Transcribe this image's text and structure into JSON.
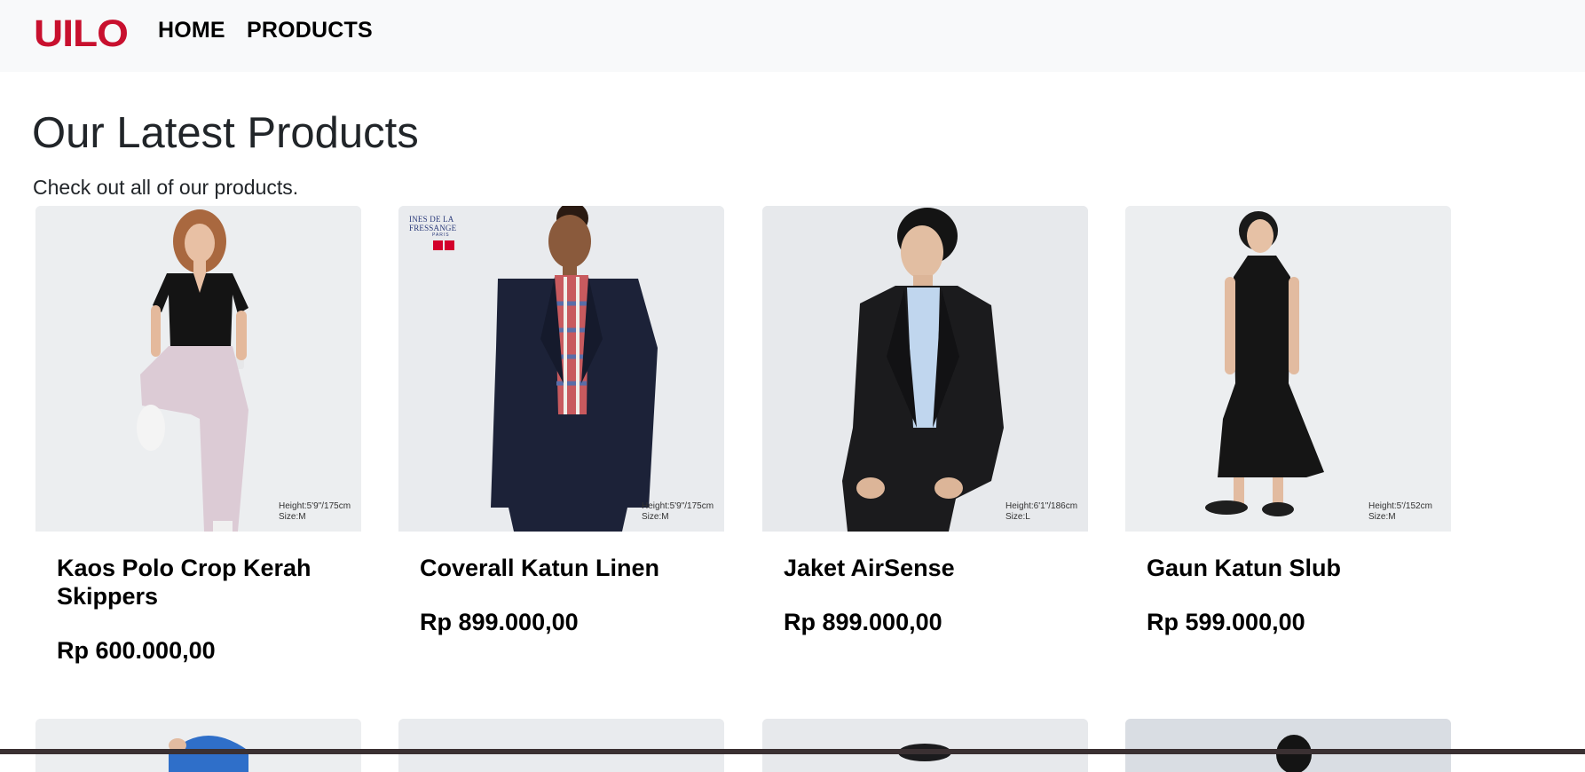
{
  "navbar": {
    "brand": "UILO",
    "links": [
      "HOME",
      "PRODUCTS"
    ]
  },
  "header": {
    "title": "Our Latest Products",
    "subtitle": "Check out all of our products."
  },
  "products": [
    {
      "name": "Kaos Polo Crop Kerah Skippers",
      "price": "Rp 600.000,00",
      "spec": [
        "Height:5'9\"/175cm",
        "Size:M"
      ]
    },
    {
      "name": "Coverall Katun Linen",
      "price": "Rp 899.000,00",
      "spec": [
        "Height:5'9\"/175cm",
        "Size:M"
      ],
      "badge": {
        "text": "INES DE LA FRESSANGE",
        "sub": "PARIS"
      }
    },
    {
      "name": "Jaket AirSense",
      "price": "Rp 899.000,00",
      "spec": [
        "Height:6'1\"/186cm",
        "Size:L"
      ]
    },
    {
      "name": "Gaun Katun Slub",
      "price": "Rp 599.000,00",
      "spec": [
        "Height:5'/152cm",
        "Size:M"
      ]
    }
  ],
  "colors": {
    "brand": "#c8102e",
    "navbar_bg": "#f8f9fa",
    "image_bg": "#ebecee"
  }
}
